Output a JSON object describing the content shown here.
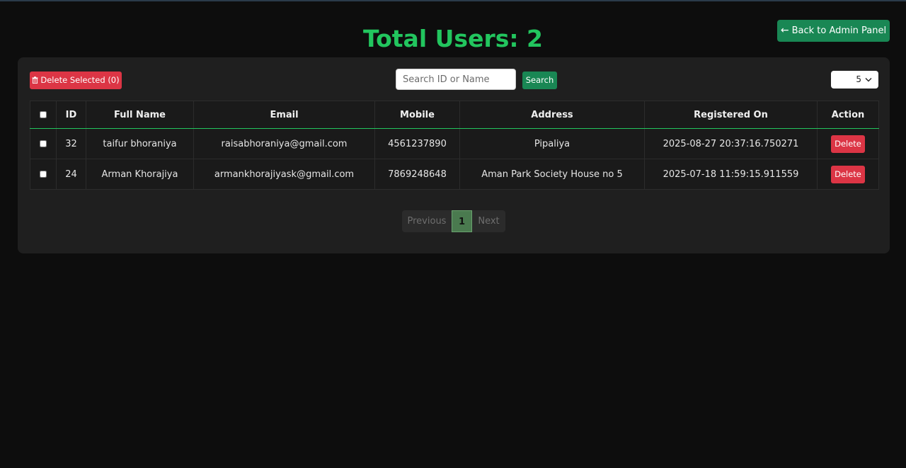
{
  "header": {
    "title": "Total Users: 2",
    "back_label": "Back to Admin Panel",
    "back_icon": "arrow-left-icon"
  },
  "toolbar": {
    "delete_selected_label": "Delete Selected (0)",
    "search_placeholder": "Search ID or Name",
    "search_value": "",
    "search_label": "Search",
    "page_size": "5"
  },
  "table": {
    "columns": [
      "ID",
      "Full Name",
      "Email",
      "Mobile",
      "Address",
      "Registered On",
      "Action"
    ],
    "rows": [
      {
        "id": "32",
        "full_name": "taifur bhoraniya",
        "email": "raisabhoraniya@gmail.com",
        "mobile": "4561237890",
        "address": "Pipaliya",
        "registered_on": "2025-08-27 20:37:16.750271",
        "action": "Delete"
      },
      {
        "id": "24",
        "full_name": "Arman Khorajiya",
        "email": "armankhorajiyask@gmail.com",
        "mobile": "7869248648",
        "address": "Aman Park Society House no 5",
        "registered_on": "2025-07-18 11:59:15.911559",
        "action": "Delete"
      }
    ]
  },
  "pagination": {
    "previous": "Previous",
    "current": "1",
    "next": "Next"
  },
  "colors": {
    "accent": "#22c55e",
    "primary_button": "#198754",
    "danger": "#dc3545",
    "background": "#0d0d0d",
    "panel": "#1f1f1f"
  }
}
